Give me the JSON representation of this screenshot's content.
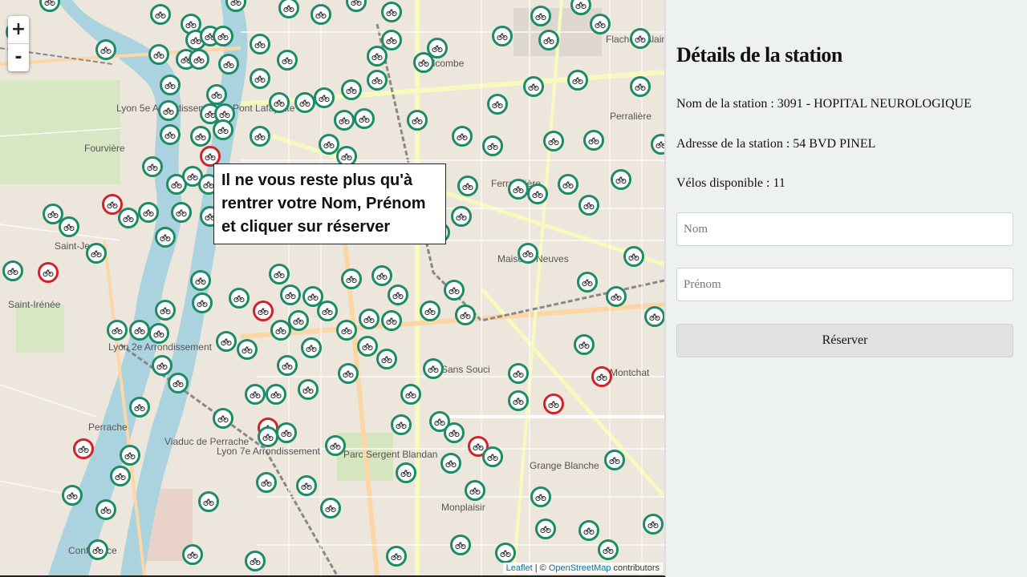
{
  "map": {
    "zoom_in": "+",
    "zoom_out": "-",
    "tooltip": "Il ne vous reste plus qu'à rentrer votre Nom, Prénom et cliquer sur réserver",
    "attribution": {
      "leaflet": "Leaflet",
      "separator": " | © ",
      "osm": "OpenStreetMap",
      "suffix": " contributors"
    },
    "place_labels": [
      "Fourvière",
      "Lyon 5e Arrondissement",
      "Saint-Irénée",
      "Saint-Jean",
      "Lyon 2e Arrondissement",
      "Perrache",
      "Lyon 7e Arrondissement",
      "Sans Souci",
      "Monplaisir",
      "Grange Blanche",
      "Perralière",
      "Maisons Neuves",
      "Montchat",
      "Belcombe",
      "Ferrandière",
      "Flachet - Alain Gilles",
      "Pont Lafayette",
      "Viaduc de Perrache",
      "Parc Sergent Blandan",
      "Confluence"
    ],
    "marker_colors": {
      "available": "#1d8b63",
      "empty": "#d2232a"
    }
  },
  "panel": {
    "title": "Détails de la station",
    "station_name": "Nom de la station : 3091 - HOPITAL NEUROLOGIQUE",
    "station_address": "Adresse de la station : 54 BVD PINEL",
    "bikes_available": "Vélos disponible : 11",
    "nom_placeholder": "Nom",
    "prenom_placeholder": "Prénom",
    "reserve_label": "Réserver"
  }
}
